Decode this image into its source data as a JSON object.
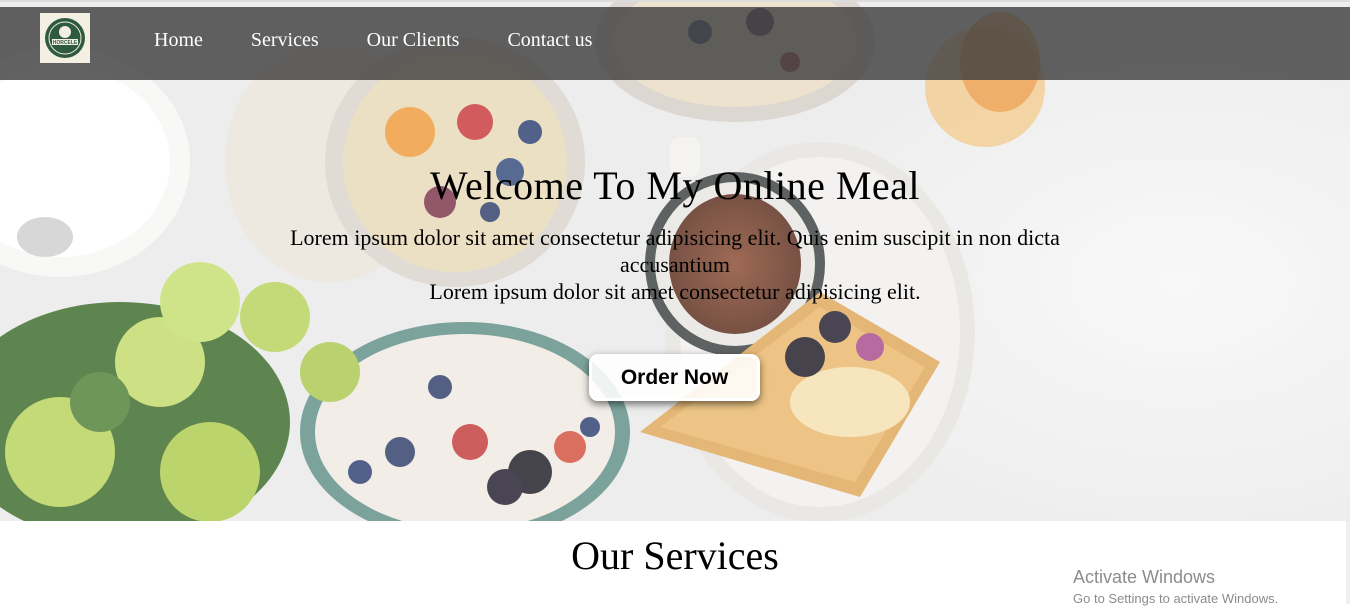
{
  "brand": {
    "logo_text": "HORCELE"
  },
  "nav": {
    "links": [
      {
        "label": "Home"
      },
      {
        "label": "Services"
      },
      {
        "label": "Our Clients"
      },
      {
        "label": "Contact us"
      }
    ]
  },
  "hero": {
    "title": "Welcome To My Online Meal",
    "description_line1": "Lorem ipsum dolor sit amet consectetur adipisicing elit. Quis enim suscipit in non dicta accusantium",
    "description_line2": "Lorem ipsum dolor sit amet consectetur adipisicing elit.",
    "button_label": "Order Now"
  },
  "services": {
    "title": "Our Services"
  },
  "watermark": {
    "title": "Activate Windows",
    "subtitle": "Go to Settings to activate Windows."
  },
  "colors": {
    "navbar_bg": "#404040",
    "nav_text": "#ffffff",
    "logo_green": "#2e5b3e"
  },
  "icons": {
    "logo": "restaurant-badge-icon"
  }
}
